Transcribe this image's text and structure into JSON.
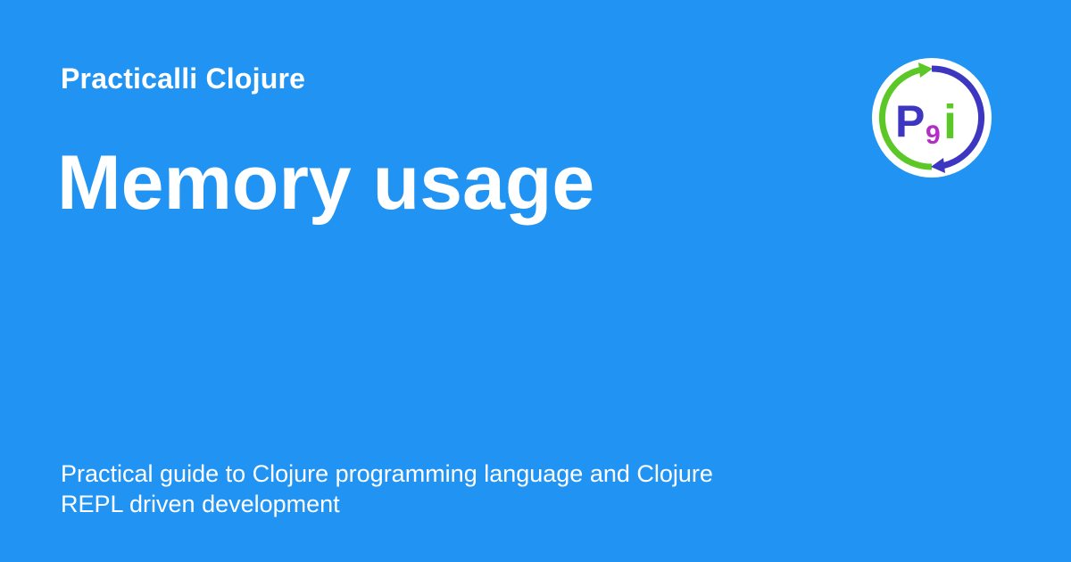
{
  "site": {
    "name": "Practicalli Clojure"
  },
  "page": {
    "title": "Memory usage",
    "description_line1": "Practical guide to Clojure programming language and Clojure",
    "description_line2": "REPL driven development"
  },
  "logo": {
    "icon": "practicalli-logo-icon",
    "letter_p": "P",
    "letter_nine": "9",
    "letter_i": "i"
  },
  "colors": {
    "background": "#2194f3",
    "text": "#ffffff",
    "logo_blue": "#3d36c0",
    "logo_green": "#5cc827",
    "logo_purple": "#b32ec5"
  }
}
